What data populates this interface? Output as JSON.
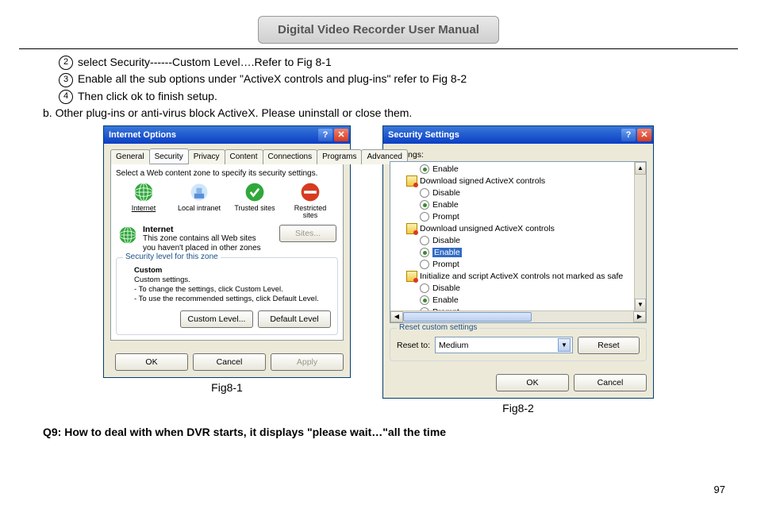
{
  "header": {
    "title": "Digital Video Recorder User Manual"
  },
  "steps": {
    "s2_num": "2",
    "s2": "select Security------Custom Level….Refer to Fig 8-1",
    "s3_num": "3",
    "s3_a": "Enable all the sub options under",
    "s3_q1": "\"",
    "s3_mid": "ActiveX controls and plug-ins",
    "s3_q2": "\"",
    "s3_b": "refer to Fig 8-2",
    "s4_num": "4",
    "s4": "Then click ok to finish setup.",
    "b": "b. Other plug-ins or anti-virus block ActiveX. Please uninstall or close them."
  },
  "fig1": {
    "caption": "Fig8-1",
    "title": "Internet Options",
    "tabs": [
      "General",
      "Security",
      "Privacy",
      "Content",
      "Connections",
      "Programs",
      "Advanced"
    ],
    "active_tab": 1,
    "instruction": "Select a Web content zone to specify its security settings.",
    "zones": [
      "Internet",
      "Local intranet",
      "Trusted sites",
      "Restricted sites"
    ],
    "zone_title": "Internet",
    "zone_desc": "This zone contains all Web sites you haven't placed in other zones",
    "sites_btn": "Sites...",
    "group_title": "Security level for this zone",
    "custom_heading": "Custom",
    "custom_l1": "Custom settings.",
    "custom_l2": "- To change the settings, click Custom Level.",
    "custom_l3": "- To use the recommended settings, click Default Level.",
    "btn_custom": "Custom Level...",
    "btn_default": "Default Level",
    "btn_ok": "OK",
    "btn_cancel": "Cancel",
    "btn_apply": "Apply"
  },
  "fig2": {
    "caption": "Fig8-2",
    "title": "Security Settings",
    "settings_label": "Settings:",
    "tree": [
      {
        "type": "radio",
        "indent": 2,
        "sel": true,
        "label": "Enable"
      },
      {
        "type": "ax",
        "indent": 1,
        "label": "Download signed ActiveX controls"
      },
      {
        "type": "radio",
        "indent": 2,
        "sel": false,
        "label": "Disable"
      },
      {
        "type": "radio",
        "indent": 2,
        "sel": true,
        "label": "Enable"
      },
      {
        "type": "radio",
        "indent": 2,
        "sel": false,
        "label": "Prompt"
      },
      {
        "type": "ax",
        "indent": 1,
        "label": "Download unsigned ActiveX controls"
      },
      {
        "type": "radio",
        "indent": 2,
        "sel": false,
        "label": "Disable"
      },
      {
        "type": "radio",
        "indent": 2,
        "sel": true,
        "label": "Enable",
        "hl": true
      },
      {
        "type": "radio",
        "indent": 2,
        "sel": false,
        "label": "Prompt"
      },
      {
        "type": "ax",
        "indent": 1,
        "label": "Initialize and script ActiveX controls not marked as safe"
      },
      {
        "type": "radio",
        "indent": 2,
        "sel": false,
        "label": "Disable"
      },
      {
        "type": "radio",
        "indent": 2,
        "sel": true,
        "label": "Enable"
      },
      {
        "type": "radio",
        "indent": 2,
        "sel": false,
        "label": "Prompt"
      }
    ],
    "reset_title": "Reset custom settings",
    "reset_label": "Reset to:",
    "reset_value": "Medium",
    "btn_reset": "Reset",
    "btn_ok": "OK",
    "btn_cancel": "Cancel"
  },
  "q9": "Q9: How to deal with when DVR starts, it displays \"please wait…\"all the time",
  "page_number": "97"
}
